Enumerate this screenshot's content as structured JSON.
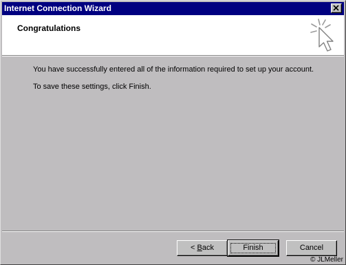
{
  "window": {
    "title": "Internet Connection Wizard"
  },
  "header": {
    "title": "Congratulations",
    "icon": "wizard-cursor-icon"
  },
  "content": {
    "message_1": "You have successfully entered all of the information required to set up your account.",
    "message_2": "To save these settings, click Finish."
  },
  "buttons": {
    "back_prefix": "< ",
    "back_mnemonic": "B",
    "back_rest": "ack",
    "finish": "Finish",
    "cancel": "Cancel"
  },
  "watermark": "© JLMeller",
  "colors": {
    "titlebar": "#000080",
    "dialog": "#bfbdbf",
    "header": "#ffffff"
  }
}
